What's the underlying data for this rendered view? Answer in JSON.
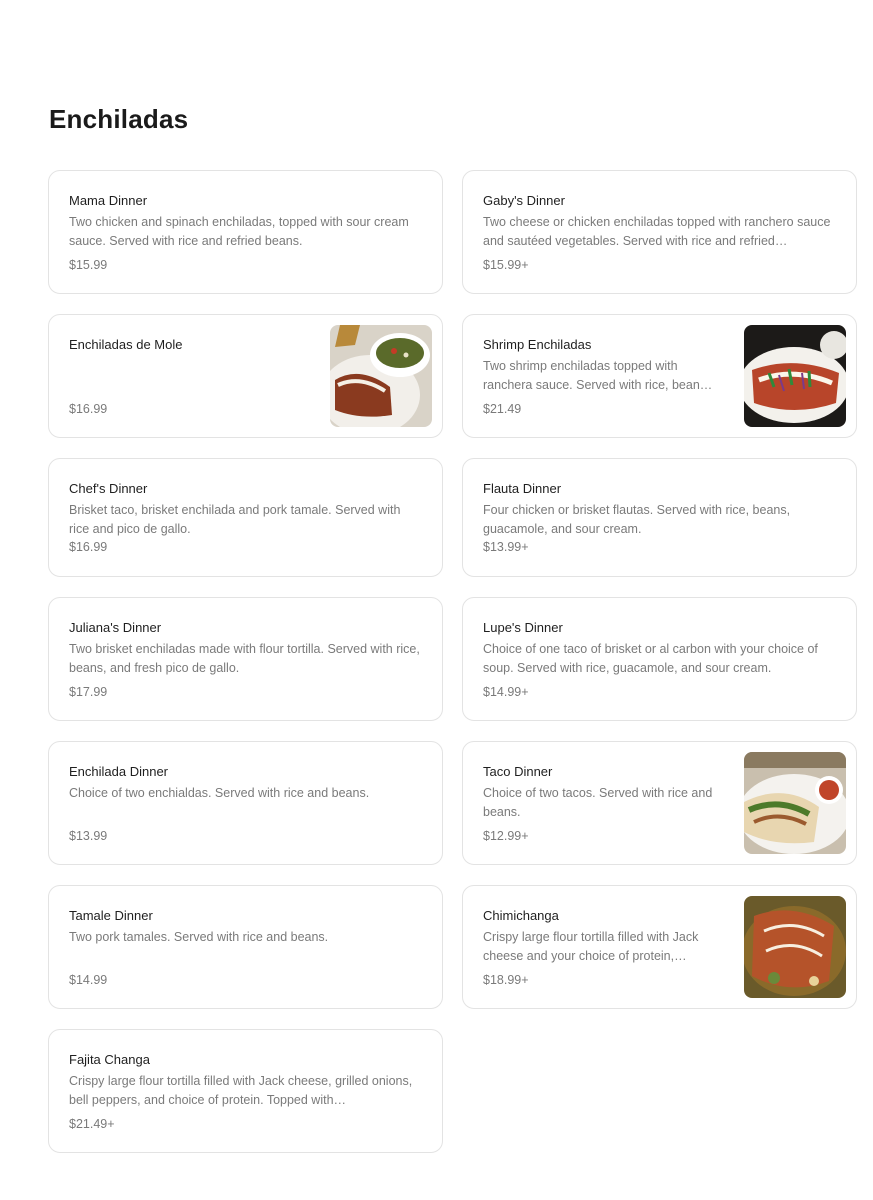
{
  "section": {
    "title": "Enchiladas"
  },
  "items": [
    {
      "name": "Mama Dinner",
      "desc": "Two chicken and spinach enchiladas, topped with sour cream sauce. Served with rice and refried beans.",
      "price": "$15.99"
    },
    {
      "name": "Gaby's Dinner",
      "desc": "Two cheese or chicken enchiladas topped with ranchero sauce and sautéed vegetables. Served with rice and refried…",
      "price": "$15.99+"
    },
    {
      "name": "Enchiladas de Mole",
      "desc": "",
      "price": "$16.99",
      "image": "enchiladas-mole-photo"
    },
    {
      "name": "Shrimp Enchiladas",
      "desc": "Two shrimp enchiladas topped with ranchera sauce. Served with rice, bean…",
      "price": "$21.49",
      "image": "shrimp-enchiladas-photo"
    },
    {
      "name": "Chef's Dinner",
      "desc": "Brisket taco, brisket enchilada and pork tamale. Served with rice and pico de gallo.",
      "price": "$16.99"
    },
    {
      "name": "Flauta Dinner",
      "desc": "Four chicken or brisket flautas. Served with rice, beans, guacamole, and sour cream.",
      "price": "$13.99+"
    },
    {
      "name": "Juliana's Dinner",
      "desc": "Two brisket enchiladas made with flour tortilla. Served with rice, beans, and fresh pico de gallo.",
      "price": "$17.99"
    },
    {
      "name": "Lupe's Dinner",
      "desc": "Choice of one taco of brisket or al carbon with your choice of soup. Served with rice, guacamole, and sour cream.",
      "price": "$14.99+"
    },
    {
      "name": "Enchilada Dinner",
      "desc": "Choice of two enchialdas. Served with rice and beans.",
      "price": "$13.99"
    },
    {
      "name": "Taco Dinner",
      "desc": "Choice of two tacos. Served with rice and beans.",
      "price": "$12.99+",
      "image": "taco-dinner-photo"
    },
    {
      "name": "Tamale Dinner",
      "desc": "Two pork tamales. Served with rice and beans.",
      "price": "$14.99"
    },
    {
      "name": "Chimichanga",
      "desc": "Crispy large flour tortilla filled with Jack cheese and your choice of protein,…",
      "price": "$18.99+",
      "image": "chimichanga-photo"
    },
    {
      "name": "Fajita Changa",
      "desc": "Crispy large flour tortilla filled with Jack cheese, grilled onions, bell peppers, and choice of protein. Topped with…",
      "price": "$21.49+"
    }
  ]
}
